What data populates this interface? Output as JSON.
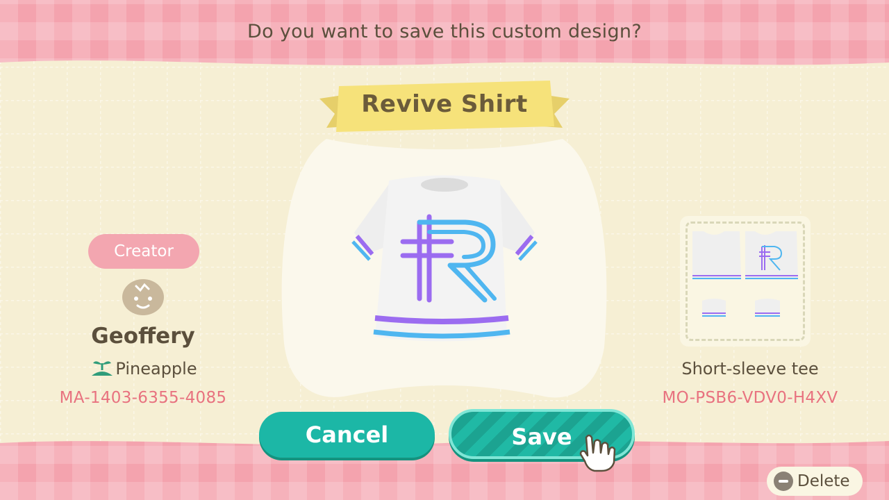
{
  "dialog": {
    "prompt": "Do you want to save this custom design?",
    "design_title": "Revive Shirt"
  },
  "creator": {
    "badge_label": "Creator",
    "name": "Geoffery",
    "island": "Pineapple",
    "creator_id": "MA-1403-6355-4085"
  },
  "design": {
    "type_label": "Short-sleeve tee",
    "design_id": "MO-PSB6-VDV0-H4XV",
    "shirt_letter": "R"
  },
  "actions": {
    "cancel_label": "Cancel",
    "save_label": "Save",
    "delete_label": "Delete"
  },
  "colors": {
    "accent_teal": "#1cb7a6",
    "pink_band": "#f4a3ae",
    "cream_panel": "#f8f1d8",
    "id_text": "#e8727f",
    "ribbon_yellow": "#f6e27a",
    "stripe_purple": "#9b6cf0",
    "stripe_blue": "#4fb6f0"
  }
}
